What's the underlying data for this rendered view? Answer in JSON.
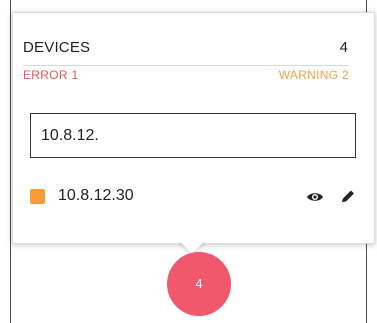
{
  "panel": {
    "title": "DEVICES",
    "count": "4",
    "error_label": "ERROR 1",
    "warning_label": "WARNING 2"
  },
  "search": {
    "value": "10.8.12.",
    "placeholder": ""
  },
  "devices": [
    {
      "ip": "10.8.12.30",
      "status_color": "#f79a3c",
      "actions": [
        "eye-icon",
        "pencil-icon"
      ]
    }
  ],
  "badge": {
    "value": "4",
    "color": "#f0596b"
  },
  "colors": {
    "error": "#e05a4f",
    "warning": "#f3a04a"
  }
}
